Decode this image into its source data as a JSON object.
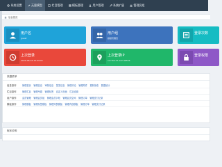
{
  "topnav": {
    "items": [
      {
        "label": "系统设置",
        "icon": "gear-icon",
        "active": false
      },
      {
        "label": "无量模型",
        "icon": "edit-icon",
        "active": true
      },
      {
        "label": "栏目管理",
        "icon": "document-icon",
        "active": false
      },
      {
        "label": "模板管理",
        "icon": "grid-icon",
        "active": false
      },
      {
        "label": "用户管理",
        "icon": "user-icon",
        "active": false
      },
      {
        "label": "系统扩展",
        "icon": "wrench-icon",
        "active": false
      },
      {
        "label": "管理员组",
        "icon": "group-icon",
        "active": false
      }
    ]
  },
  "breadcrumb": {
    "label": "后台首页"
  },
  "cards": [
    {
      "label": "用户名",
      "value": "guest",
      "icon": "user-icon",
      "color": "#1fa3d9"
    },
    {
      "label": "用户组",
      "value": "超级管理员",
      "icon": "group-icon",
      "color": "#3d73bd"
    },
    {
      "label": "登录次数",
      "value": "",
      "icon": "list-icon",
      "color": "#16bcc3"
    },
    {
      "label": "上次登录",
      "value": "2020-06-16 15:49:01",
      "icon": "clock-icon",
      "color": "#e9483b"
    },
    {
      "label": "上次登录IP",
      "value": "117.60.27.147:46536",
      "icon": "location-icon",
      "color": "#20b76a"
    },
    {
      "label": "登录权限",
      "value": "",
      "icon": "lock-icon",
      "color": "#8e58c7"
    }
  ],
  "quick": {
    "title": "快捷菜单",
    "rows": [
      {
        "category": "信息操作",
        "links": [
          "管理首页",
          "管理信息",
          "审核信息",
          "签发信息",
          "管理评论",
          "管理附件",
          "更新静态",
          "数据统计"
        ]
      },
      {
        "category": "栏目操作",
        "links": [
          "管理栏目",
          "管理专题",
          "管理标签",
          "自定义页面",
          "栏目设置"
        ]
      },
      {
        "category": "用户操作",
        "links": [
          "会员管理",
          "管理会员组",
          "管理会员字段",
          "管理会员空间",
          "管理订单",
          "管理支付记录"
        ]
      },
      {
        "category": "模板操作",
        "links": [
          "管理模板",
          "管理标签模板",
          "管理列表模板",
          "管理内容模板",
          "管理订单",
          "管理支付记录"
        ]
      }
    ]
  },
  "system": {
    "title": "程序说明"
  },
  "colors": {
    "nav": "#2f4050",
    "navActive": "#4a5f73",
    "link": "#3d73bd"
  }
}
